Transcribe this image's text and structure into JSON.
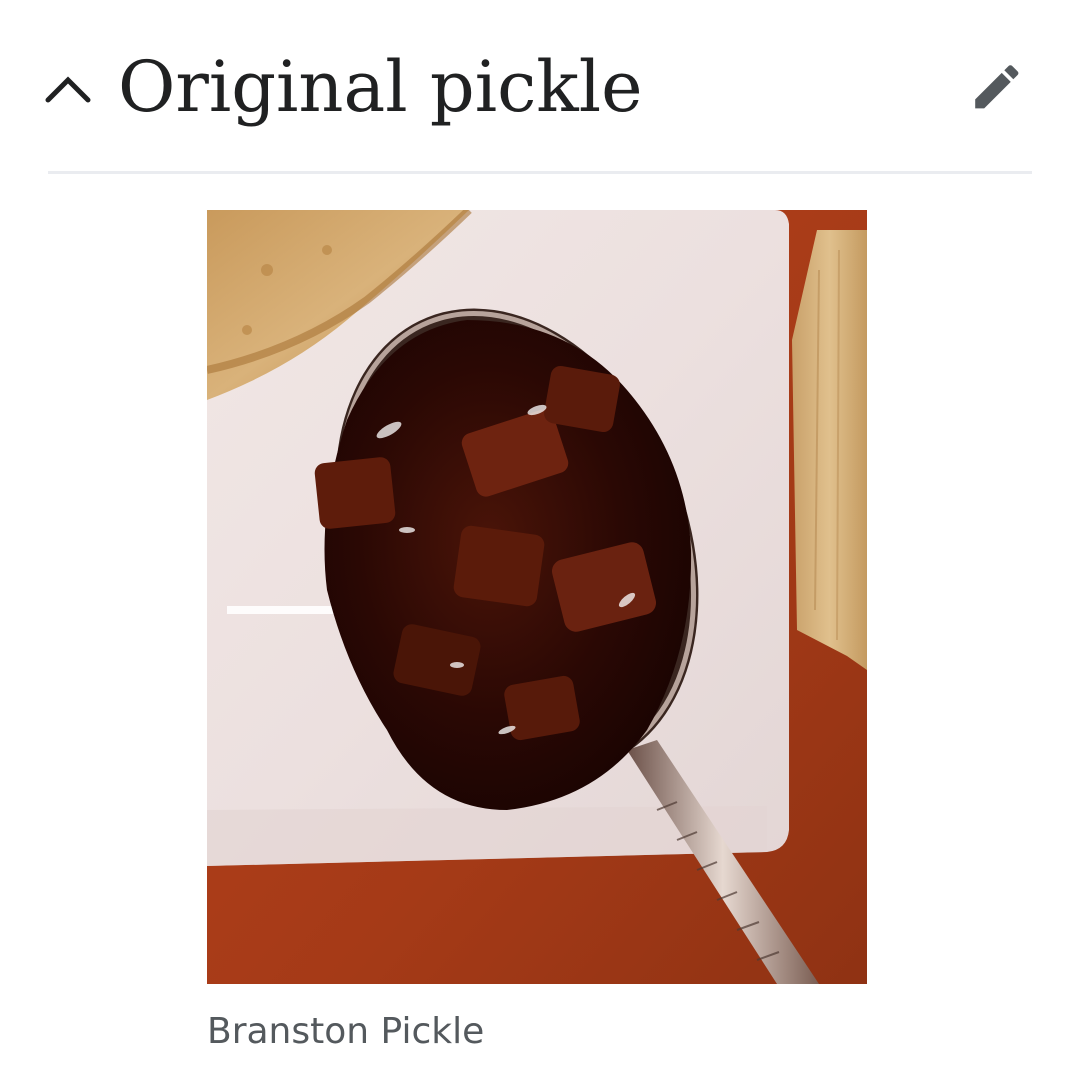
{
  "section": {
    "title": "Original pickle",
    "collapse_icon": "chevron-up-icon",
    "edit_icon": "pencil-icon"
  },
  "figure": {
    "caption": "Branston Pickle"
  },
  "colors": {
    "title_text": "#202122",
    "icon": "#54595d",
    "divider": "#eaecf0",
    "caption_text": "#54595d"
  }
}
